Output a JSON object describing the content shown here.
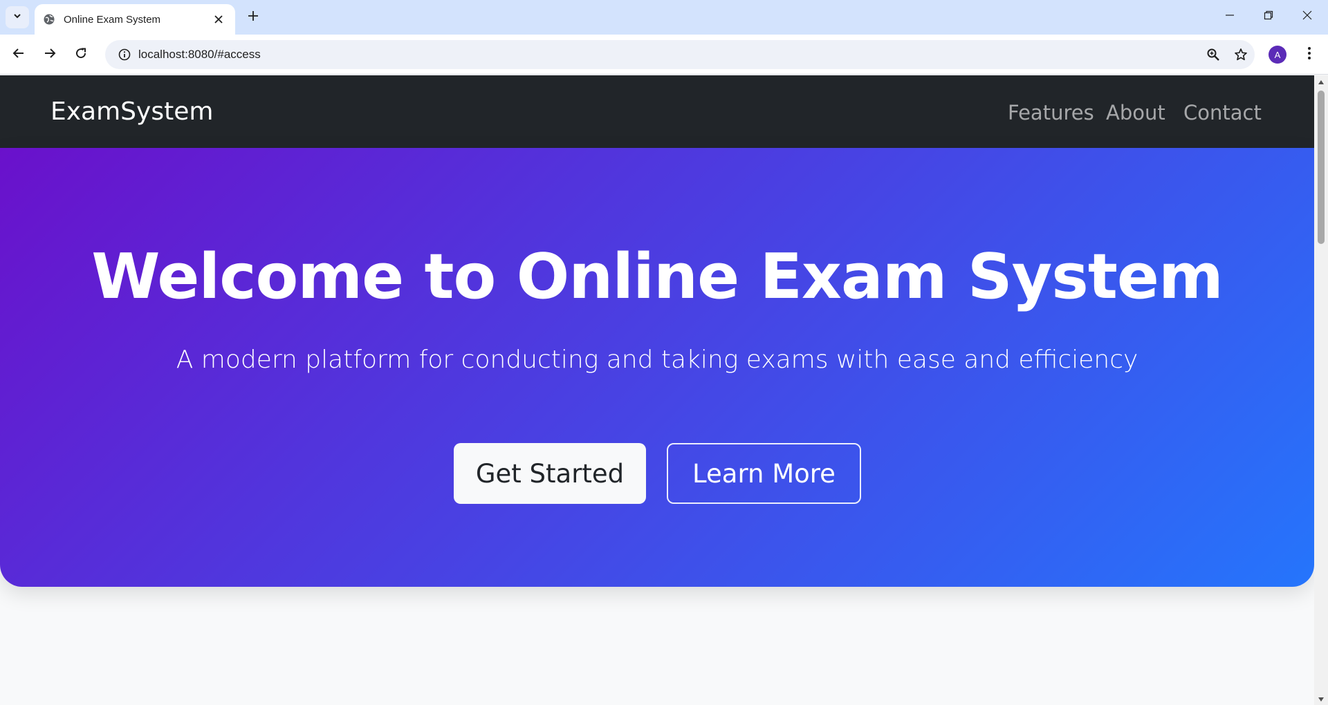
{
  "browser": {
    "tab_title": "Online Exam System",
    "url": "localhost:8080/#access",
    "profile_initial": "A",
    "icons": {
      "tab_search": "chevron-down-icon",
      "favicon": "globe-icon",
      "tab_close": "close-icon",
      "new_tab": "plus-icon",
      "minimize": "minimize-icon",
      "restore": "restore-icon",
      "close_window": "close-icon",
      "back": "back-arrow-icon",
      "forward": "forward-arrow-icon",
      "reload": "reload-icon",
      "site_info": "info-icon",
      "zoom": "zoom-icon",
      "bookmark": "star-icon",
      "menu": "kebab-menu-icon"
    }
  },
  "navbar": {
    "brand": "ExamSystem",
    "links": [
      {
        "label": "Features"
      },
      {
        "label": "About"
      },
      {
        "label": "Contact"
      }
    ]
  },
  "hero": {
    "title": "Welcome to Online Exam System",
    "subtitle": "A modern platform for conducting and taking exams with ease and efficiency",
    "primary_button": "Get Started",
    "secondary_button": "Learn More",
    "gradient_start": "#6a11cb",
    "gradient_end": "#2575fc"
  },
  "colors": {
    "navbar_bg": "#212529",
    "page_bg": "#f8f9fa",
    "tabstrip_bg": "#d3e3fd",
    "avatar_bg": "#5b2bb7"
  }
}
